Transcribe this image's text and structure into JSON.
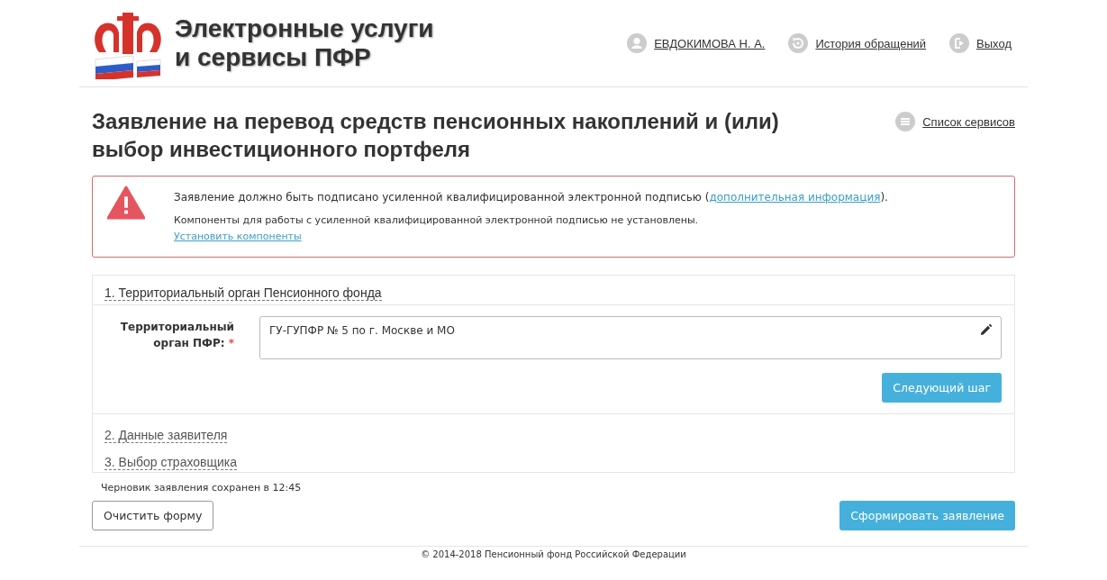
{
  "header": {
    "title_line1": "Электронные услуги",
    "title_line2": "и сервисы ПФР",
    "nav": [
      {
        "kind": "user",
        "label": "ЕВДОКИМОВА Н. А."
      },
      {
        "kind": "history",
        "label": "История обращений"
      },
      {
        "kind": "exit",
        "label": "Выход"
      }
    ]
  },
  "page": {
    "title": "Заявление на перевод средств пенсионных накоплений и (или) выбор инвестиционного портфеля",
    "services_link": "Список сервисов"
  },
  "alert": {
    "message": "Заявление должно быть подписано усиленной квалифицированной электронной подписью (",
    "message_link": "дополнительная информация",
    "message_end": ").",
    "note": "Компоненты для работы с усиленной квалифицированной электронной подписью не установлены.",
    "install_link": "Установить компоненты"
  },
  "steps": [
    {
      "title": "1. Территориальный орган Пенсионного фонда",
      "expanded": true,
      "field_label": "Территориальный орган ПФР:",
      "required_mark": "*",
      "field_value": "ГУ-ГУПФР № 5 по г. Москве и МО",
      "next_button": "Следующий шаг"
    },
    {
      "title": "2. Данные заявителя",
      "expanded": false
    },
    {
      "title": "3. Выбор страховщика",
      "expanded": false
    }
  ],
  "draft_status": "Черновик заявления сохранен в 12:45",
  "buttons": {
    "clear": "Очистить форму",
    "submit": "Сформировать заявление"
  },
  "footer": "© 2014-2018 Пенсионный фонд Российской Федерации"
}
